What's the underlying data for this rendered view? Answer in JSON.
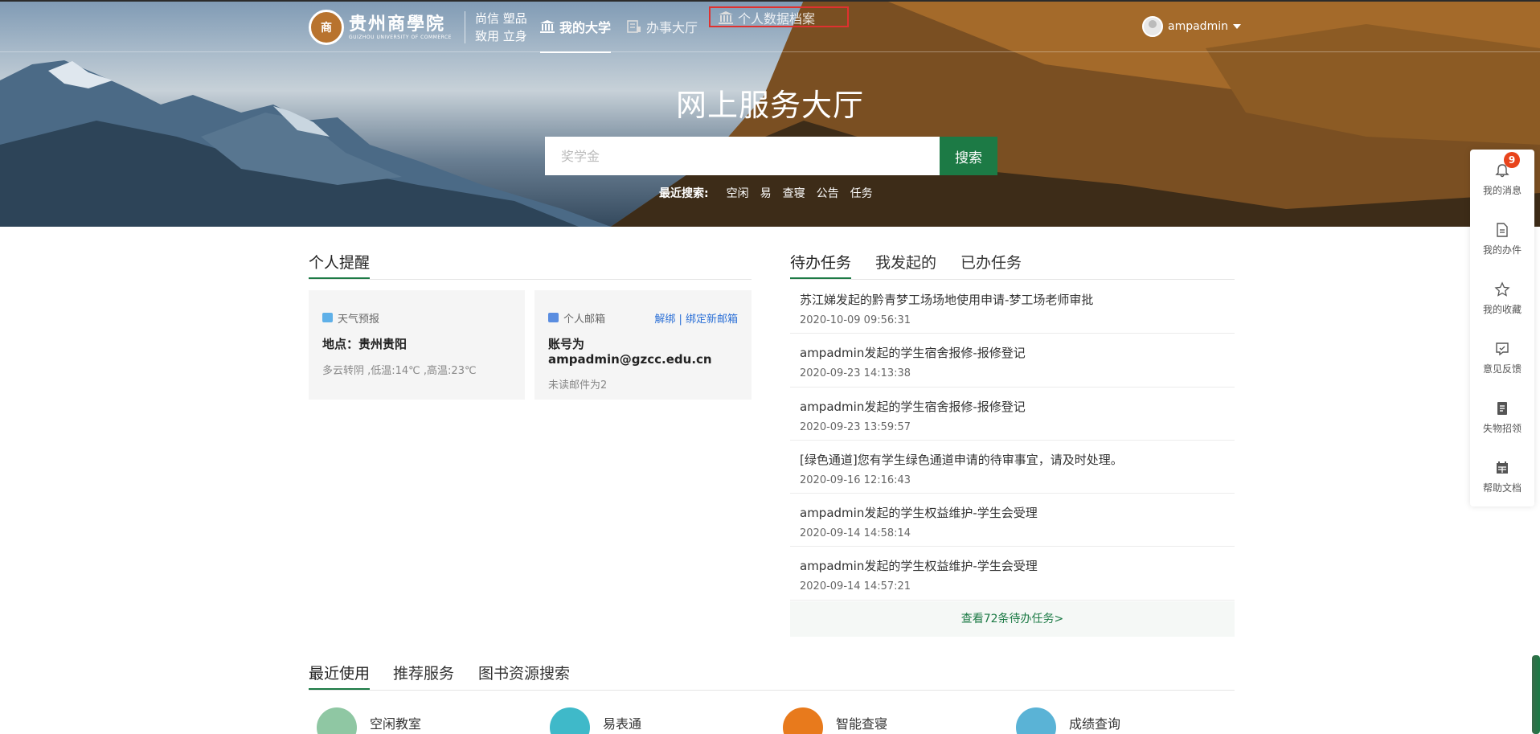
{
  "header": {
    "logo_cn": "贵州商學院",
    "logo_en": "GUIZHOU UNIVERSITY OF COMMERCE",
    "motto_line1": "尚信 塑品",
    "motto_line2": "致用 立身",
    "nav": [
      {
        "label": "我的大学",
        "icon": "bank-icon",
        "active": true
      },
      {
        "label": "办事大厅",
        "icon": "form-icon",
        "active": false
      },
      {
        "label": "个人数据档案",
        "icon": "bank-icon",
        "active": false
      }
    ],
    "username": "ampadmin"
  },
  "hero": {
    "title": "网上服务大厅",
    "search_placeholder": "奖学金",
    "search_button": "搜索",
    "recent_label": "最近搜索:",
    "recent_keywords": [
      "空闲",
      "易",
      "查寝",
      "公告",
      "任务"
    ]
  },
  "reminder": {
    "title": "个人提醒",
    "weather": {
      "head": "天气预报",
      "location": "地点：贵州贵阳",
      "detail": "多云转阴 ,低温:14℃ ,高温:23℃"
    },
    "mail": {
      "head": "个人邮箱",
      "link": "解绑 | 绑定新邮箱",
      "account": "账号为ampadmin@gzcc.edu.cn",
      "unread": "未读邮件为2"
    }
  },
  "tasks": {
    "tabs": [
      "待办任务",
      "我发起的",
      "已办任务"
    ],
    "items": [
      {
        "title": "苏江娣发起的黔青梦工场场地使用申请-梦工场老师审批",
        "date": "2020-10-09 09:56:31"
      },
      {
        "title": "ampadmin发起的学生宿舍报修-报修登记",
        "date": "2020-09-23 14:13:38"
      },
      {
        "title": "ampadmin发起的学生宿舍报修-报修登记",
        "date": "2020-09-23 13:59:57"
      },
      {
        "title": "[绿色通道]您有学生绿色通道申请的待审事宜，请及时处理。",
        "date": "2020-09-16 12:16:43"
      },
      {
        "title": "ampadmin发起的学生权益维护-学生会受理",
        "date": "2020-09-14 14:58:14"
      },
      {
        "title": "ampadmin发起的学生权益维护-学生会受理",
        "date": "2020-09-14 14:57:21"
      }
    ],
    "more": "查看72条待办任务>"
  },
  "bottom": {
    "tabs": [
      "最近使用",
      "推荐服务",
      "图书资源搜索"
    ],
    "apps": [
      {
        "name": "空闲教室",
        "color": "#8fc7a3"
      },
      {
        "name": "易表通",
        "color": "#3fb9c9"
      },
      {
        "name": "智能查寝",
        "color": "#e87a1c"
      },
      {
        "name": "成绩查询",
        "color": "#5ab3d6"
      }
    ]
  },
  "sidebar": {
    "items": [
      {
        "label": "我的消息",
        "icon": "bell-icon",
        "badge": "9"
      },
      {
        "label": "我的办件",
        "icon": "document-icon"
      },
      {
        "label": "我的收藏",
        "icon": "star-icon"
      },
      {
        "label": "意见反馈",
        "icon": "feedback-icon"
      },
      {
        "label": "失物招领",
        "icon": "clipboard-icon"
      },
      {
        "label": "帮助文档",
        "icon": "calendar-icon"
      }
    ]
  },
  "colors": {
    "accent": "#1c7a45",
    "badge": "#e8441c",
    "link": "#2a6fd6",
    "highlight_box": "#e0312f"
  }
}
